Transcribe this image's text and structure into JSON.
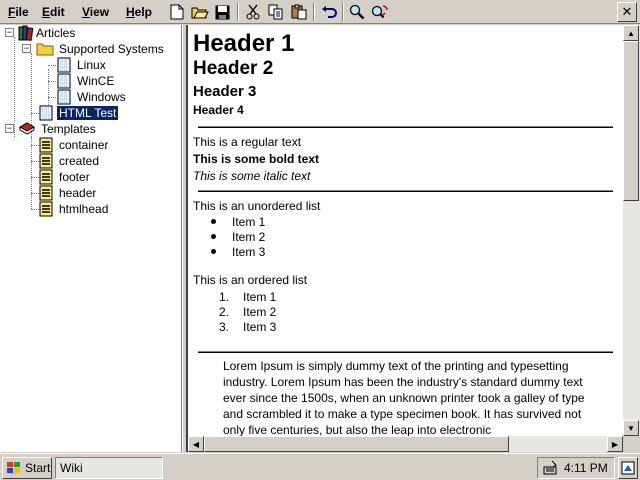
{
  "menu": [
    {
      "first": "F",
      "rest": "ile"
    },
    {
      "first": "E",
      "rest": "dit"
    },
    {
      "first": "V",
      "rest": "iew"
    },
    {
      "first": "H",
      "rest": "elp"
    }
  ],
  "toolbar": {
    "buttons": [
      "new-icon",
      "open-icon",
      "save-icon",
      "cut-icon",
      "copy-icon",
      "paste-icon",
      "undo-icon",
      "find-icon",
      "replace-icon"
    ],
    "close_label": "✕"
  },
  "tree": {
    "articles": "Articles",
    "supported_systems": "Supported Systems",
    "linux": "Linux",
    "wince": "WinCE",
    "windows": "Windows",
    "html_test": "HTML Test",
    "templates": "Templates",
    "container": "container",
    "created": "created",
    "footer": "footer",
    "header": "header",
    "htmlhead": "htmlhead",
    "expanded_symbol": "−"
  },
  "document": {
    "h1": "Header 1",
    "h2": "Header 2",
    "h3": "Header 3",
    "h4": "Header 4",
    "regular": "This is a regular text",
    "bold": "This is some bold text",
    "italic": "This is some italic text",
    "ul_caption": "This is an unordered list",
    "ul_items": [
      "Item 1",
      "Item 2",
      "Item 3"
    ],
    "ol_caption": "This is an ordered list",
    "ol_numbers": [
      "1.",
      "2.",
      "3."
    ],
    "ol_items": [
      "Item 1",
      "Item 2",
      "Item 3"
    ],
    "paragraph": "Lorem Ipsum is simply dummy text of the printing and typesetting industry. Lorem Ipsum has been the industry's standard dummy text ever since the 1500s, when an unknown printer took a galley of type and scrambled it to make a type specimen book. It has survived not only five centuries, but also the leap into electronic"
  },
  "taskbar": {
    "start": "Start",
    "task": "Wiki",
    "time": "4:11 PM"
  },
  "colors": {
    "selection": "#0a246a",
    "face": "#d4d0c8",
    "folder": "#f4d03f"
  }
}
